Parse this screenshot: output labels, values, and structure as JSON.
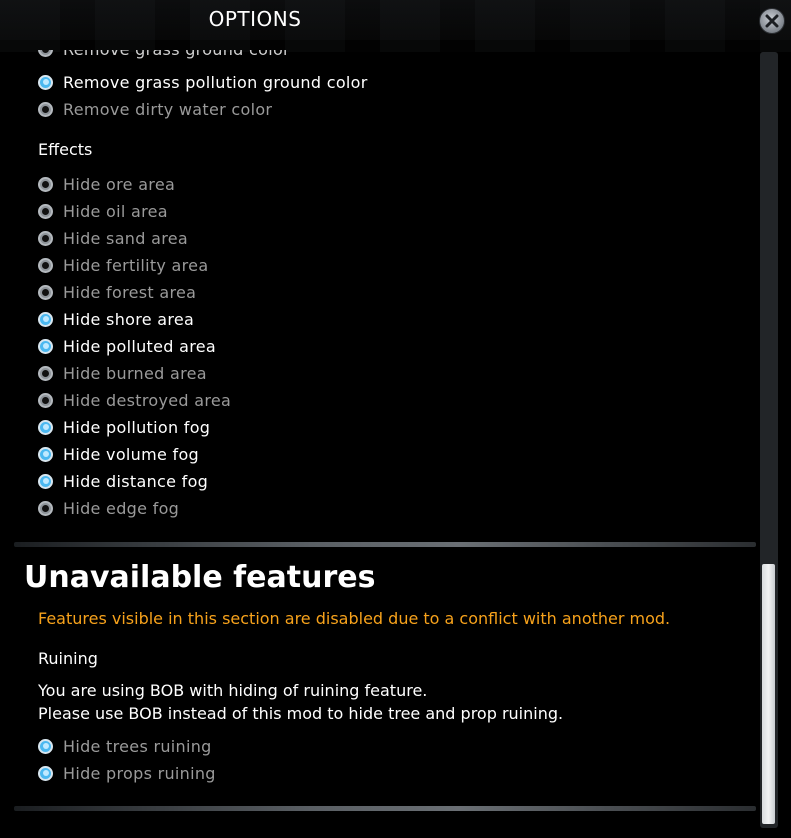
{
  "window": {
    "title": "OPTIONS"
  },
  "top_options": [
    {
      "label": "Remove grass pollution ground color",
      "checked": true
    },
    {
      "label": "Remove dirty water color",
      "checked": false
    }
  ],
  "effects": {
    "heading": "Effects",
    "options": [
      {
        "label": "Hide ore area",
        "checked": false
      },
      {
        "label": "Hide oil area",
        "checked": false
      },
      {
        "label": "Hide sand area",
        "checked": false
      },
      {
        "label": "Hide fertility area",
        "checked": false
      },
      {
        "label": "Hide forest area",
        "checked": false
      },
      {
        "label": "Hide shore area",
        "checked": true
      },
      {
        "label": "Hide polluted area",
        "checked": true
      },
      {
        "label": "Hide burned area",
        "checked": false
      },
      {
        "label": "Hide destroyed area",
        "checked": false
      },
      {
        "label": "Hide pollution fog",
        "checked": true
      },
      {
        "label": "Hide volume fog",
        "checked": true
      },
      {
        "label": "Hide distance fog",
        "checked": true
      },
      {
        "label": "Hide edge fog",
        "checked": false
      }
    ]
  },
  "unavailable": {
    "title": "Unavailable features",
    "warning": "Features visible in this section are disabled due to a conflict with another mod.",
    "ruining": {
      "heading": "Ruining",
      "message_line1": "You are using BOB with hiding of ruining feature.",
      "message_line2": "Please use BOB instead of this mod to hide tree and prop ruining.",
      "options": [
        {
          "label": "Hide trees ruining",
          "checked": true
        },
        {
          "label": "Hide props ruining",
          "checked": true
        }
      ]
    }
  },
  "colors": {
    "accent": "#4bb8f0",
    "warning": "#f7a21b",
    "disabled_text": "#9a9a9a"
  },
  "icons": {
    "close": "close-icon",
    "radio": "radio-icon"
  }
}
